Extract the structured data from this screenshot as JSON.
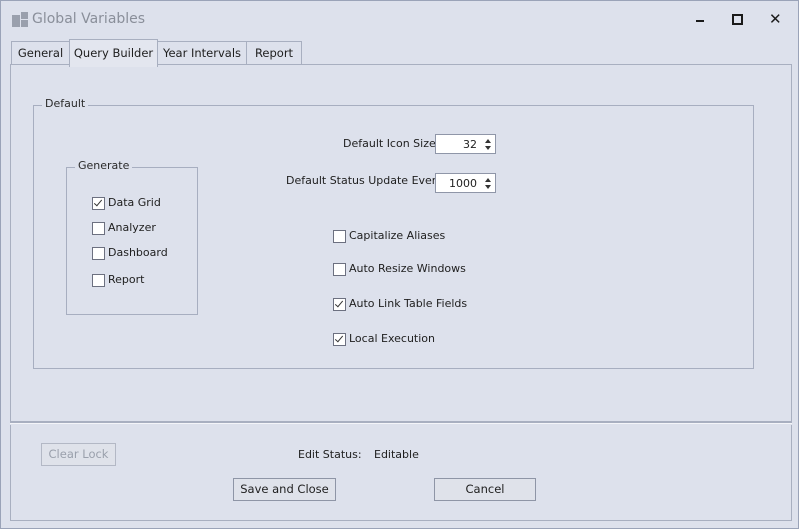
{
  "window": {
    "title": "Global Variables",
    "icon": "app-window-icon",
    "controls": {
      "minimize": "minimize-icon",
      "maximize": "maximize-icon",
      "close": "close-icon"
    }
  },
  "tabs": [
    {
      "label": "General",
      "active": false
    },
    {
      "label": "Query Builder",
      "active": true
    },
    {
      "label": "Year Intervals",
      "active": false
    },
    {
      "label": "Report",
      "active": false
    }
  ],
  "default_group": {
    "title": "Default",
    "icon_size": {
      "label": "Default Icon Size",
      "value": "32"
    },
    "status_update": {
      "label": "Default Status Update Every",
      "value": "1000"
    },
    "options": [
      {
        "label": "Capitalize Aliases",
        "checked": false
      },
      {
        "label": "Auto Resize Windows",
        "checked": false
      },
      {
        "label": "Auto Link Table Fields",
        "checked": true
      },
      {
        "label": "Local Execution",
        "checked": true
      }
    ]
  },
  "generate_group": {
    "title": "Generate",
    "items": [
      {
        "label": "Data Grid",
        "checked": true
      },
      {
        "label": "Analyzer",
        "checked": false
      },
      {
        "label": "Dashboard",
        "checked": false
      },
      {
        "label": "Report",
        "checked": false
      }
    ]
  },
  "footer": {
    "clear_lock": "Clear Lock",
    "edit_status_label": "Edit Status:",
    "edit_status_value": "Editable",
    "save_close": "Save and Close",
    "cancel": "Cancel"
  }
}
